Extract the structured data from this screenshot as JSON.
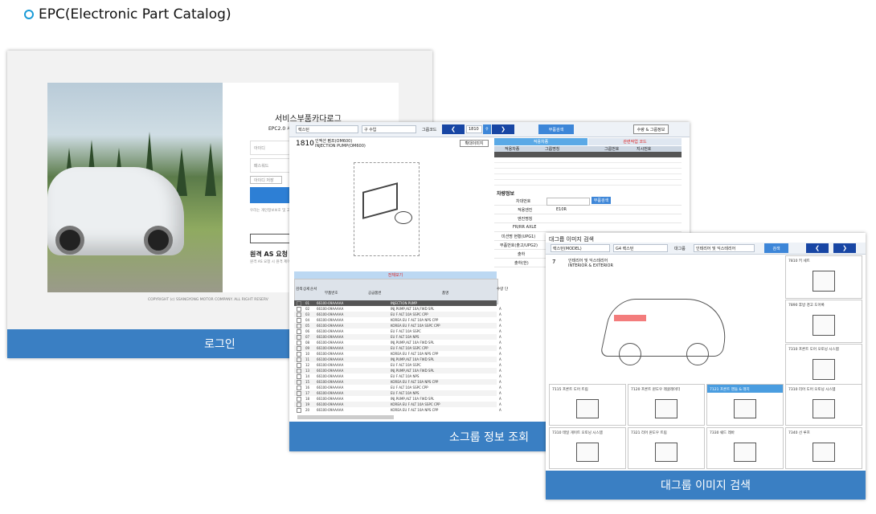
{
  "heading": "EPC(Electronic Part Catalog)",
  "login": {
    "title": "서비스부품카다로그",
    "subtitle": "EPC2.0 시",
    "id_placeholder": "아이디",
    "pw_placeholder": "패스워드",
    "save_id": "아이디 저장",
    "notice": "우리는 개인정보보호 및 고객관리 목적에 해당하거나 누출되지",
    "language": "KOREAN",
    "as_title": "원격 AS 요청",
    "as_sub": "원격 AS 요청 시 원격 제어를 이용한",
    "copyright": "COPYRIGHT (c) SSANGYONG MOTOR COMPANY. ALL RIGHT RESERV",
    "caption": "로그인"
  },
  "subgroup": {
    "toolbar": {
      "model": "렉스턴",
      "category": "구 수입",
      "group": "그룹코드",
      "page": "1810",
      "search": "부품검색",
      "view_btn": "수량 & 그룹정보"
    },
    "part_no": "1810",
    "part_name_kr": "인젝션 펌프(OM600)",
    "part_name_en": "INJECTION PUMP(OM600)",
    "image_btn": "확대이미지",
    "tab_left": "적용차종",
    "tab_right": "관련작업 코드",
    "cols": [
      "적용차종",
      "그룹명칭",
      "그룹번호",
      "지시번호"
    ],
    "vehicle_title": "차량정보",
    "vehicle_labels": [
      "차대번호",
      "적용엔진",
      "엔진명칭",
      "FR/RR AXLE",
      "미션명 현황(UPG1)",
      "부품번호(출고/UPG2)",
      "출하",
      "출하(한)"
    ],
    "vehicle_vals": [
      "",
      "E10R",
      "",
      "",
      "",
      "",
      "",
      ""
    ],
    "list_title": "전체보기",
    "list_cols": [
      "검색",
      "상세",
      "순서",
      "부품번호",
      "공급품번",
      "품명",
      "수량",
      "단"
    ],
    "rows": [
      {
        "no": "01",
        "part": "66100-09AAAAA",
        "name": "INJECTION PUMP",
        "qty": "A"
      },
      {
        "no": "02",
        "part": "66100-09AAAAA",
        "name": "INJ.PUMP,ALT 10A,FWD SPL",
        "qty": "A"
      },
      {
        "no": "03",
        "part": "66100-09AAAAA",
        "name": "EU F ALT 10A SSPC CPP",
        "qty": "A"
      },
      {
        "no": "04",
        "part": "66100-09AAAAA",
        "name": "KOREA EU F ALT 10A NPS CPP",
        "qty": "A"
      },
      {
        "no": "05",
        "part": "66100-09AAAAA",
        "name": "KOREA EU F ALT 10A SSPC CPP",
        "qty": "A"
      },
      {
        "no": "06",
        "part": "66100-09AAAAA",
        "name": "EU F ALT 10A SSPC",
        "qty": "A"
      },
      {
        "no": "07",
        "part": "66100-09AAAAA",
        "name": "EU F ALT 10A NPS",
        "qty": "A"
      },
      {
        "no": "08",
        "part": "66100-09AAAAA",
        "name": "INJ.PUMP,ALT 10A FWD SPL",
        "qty": "A"
      },
      {
        "no": "09",
        "part": "66100-09AAAAA",
        "name": "EU F ALT 10A SSPC CPP",
        "qty": "A"
      },
      {
        "no": "10",
        "part": "66100-09AAAAA",
        "name": "KOREA EU F ALT 10A NPS CPP",
        "qty": "A"
      },
      {
        "no": "11",
        "part": "66100-09AAAAA",
        "name": "INJ.PUMP,ALT 10A FWD SPL",
        "qty": "A"
      },
      {
        "no": "12",
        "part": "66100-09AAAAA",
        "name": "EU F ALT 10A SSPC",
        "qty": "A"
      },
      {
        "no": "13",
        "part": "66100-09AAAAA",
        "name": "INJ.PUMP,ALT 10A FWD SPL",
        "qty": "A"
      },
      {
        "no": "14",
        "part": "66100-09AAAAA",
        "name": "EU F ALT 10A NPS",
        "qty": "A"
      },
      {
        "no": "15",
        "part": "66100-09AAAAA",
        "name": "KOREA EU F ALT 10A NPS CPP",
        "qty": "A"
      },
      {
        "no": "16",
        "part": "66100-09AAAAA",
        "name": "EU F ALT 10A SSPC CPP",
        "qty": "A"
      },
      {
        "no": "17",
        "part": "66100-09AAAAA",
        "name": "EU F ALT 10A NPS",
        "qty": "A"
      },
      {
        "no": "18",
        "part": "66100-09AAAAA",
        "name": "INJ.PUMP,ALT 10A FWD SPL",
        "qty": "A"
      },
      {
        "no": "19",
        "part": "66100-09AAAAA",
        "name": "KOREA EU F ALT 10A SSPC CPP",
        "qty": "A"
      },
      {
        "no": "20",
        "part": "66100-09AAAAA",
        "name": "KOREA EU F ALT 10A NPS CPP",
        "qty": "A"
      }
    ],
    "caption": "소그룹 정보 조회"
  },
  "biggroup": {
    "toolbar": {
      "model": "렉스턴(MODEL)",
      "category": "G4 렉스턴",
      "group_label": "대그룹",
      "group": "인테리어 및 익스테리어",
      "search": "검색"
    },
    "title": "대그룹 이미지 검색",
    "group_no": "7",
    "group_name_kr": "인테리어 및 익스테리어",
    "group_name_en": "INTERIOR & EXTERIOR",
    "side": [
      "7810 키 세트",
      "7890 후방 경고 도어록",
      "7310 프론트 도어 오토닝 시스템"
    ],
    "bottom_row1": [
      "7115 프론트 도어 트림",
      "7120 프론트 윈도우 레귤레이터",
      "7121 프론트 핸들 & 래치",
      "7310 리어 도어 오토닝 시스템"
    ],
    "bottom_row2": [
      "7310 테일 게이트 오토닝 시스템",
      "7321 리어 윈도우 트림",
      "7330 쉐드 레바",
      "7340 선 루프"
    ],
    "caption": "대그룹 이미지 검색"
  }
}
